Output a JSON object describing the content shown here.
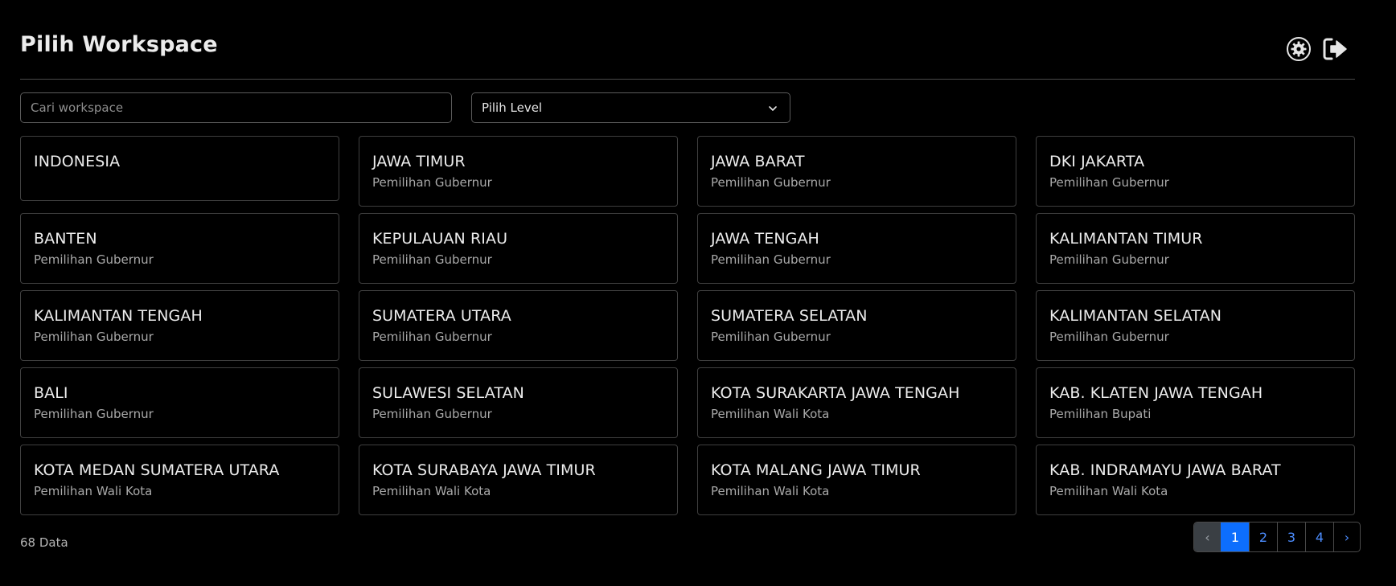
{
  "header": {
    "title": "Pilih Workspace"
  },
  "search": {
    "placeholder": "Cari workspace",
    "value": ""
  },
  "level_select": {
    "selected": "Pilih Level"
  },
  "workspaces": [
    {
      "name": "INDONESIA",
      "type": ""
    },
    {
      "name": "JAWA TIMUR",
      "type": "Pemilihan Gubernur"
    },
    {
      "name": "JAWA BARAT",
      "type": "Pemilihan Gubernur"
    },
    {
      "name": "DKI JAKARTA",
      "type": "Pemilihan Gubernur"
    },
    {
      "name": "BANTEN",
      "type": "Pemilihan Gubernur"
    },
    {
      "name": "KEPULAUAN RIAU",
      "type": "Pemilihan Gubernur"
    },
    {
      "name": "JAWA TENGAH",
      "type": "Pemilihan Gubernur"
    },
    {
      "name": "KALIMANTAN TIMUR",
      "type": "Pemilihan Gubernur"
    },
    {
      "name": "KALIMANTAN TENGAH",
      "type": "Pemilihan Gubernur"
    },
    {
      "name": "SUMATERA UTARA",
      "type": "Pemilihan Gubernur"
    },
    {
      "name": "SUMATERA SELATAN",
      "type": "Pemilihan Gubernur"
    },
    {
      "name": "KALIMANTAN SELATAN",
      "type": "Pemilihan Gubernur"
    },
    {
      "name": "BALI",
      "type": "Pemilihan Gubernur"
    },
    {
      "name": "SULAWESI SELATAN",
      "type": "Pemilihan Gubernur"
    },
    {
      "name": "KOTA SURAKARTA JAWA TENGAH",
      "type": "Pemilihan Wali Kota"
    },
    {
      "name": "KAB. KLATEN JAWA TENGAH",
      "type": "Pemilihan Bupati"
    },
    {
      "name": "KOTA MEDAN SUMATERA UTARA",
      "type": "Pemilihan Wali Kota"
    },
    {
      "name": "KOTA SURABAYA JAWA TIMUR",
      "type": "Pemilihan Wali Kota"
    },
    {
      "name": "KOTA MALANG JAWA TIMUR",
      "type": "Pemilihan Wali Kota"
    },
    {
      "name": "KAB. INDRAMAYU JAWA BARAT",
      "type": "Pemilihan Wali Kota"
    }
  ],
  "footer": {
    "total": "68 Data"
  },
  "pagination": {
    "prev": "‹",
    "next": "›",
    "pages": [
      "1",
      "2",
      "3",
      "4"
    ],
    "current": "1"
  },
  "colors": {
    "background": "#000000",
    "accent": "#0d6efd",
    "link": "#4c8dff"
  },
  "icons": {
    "settings": "gear-icon",
    "logout": "logout-icon",
    "dropdown": "chevron-down-icon"
  }
}
